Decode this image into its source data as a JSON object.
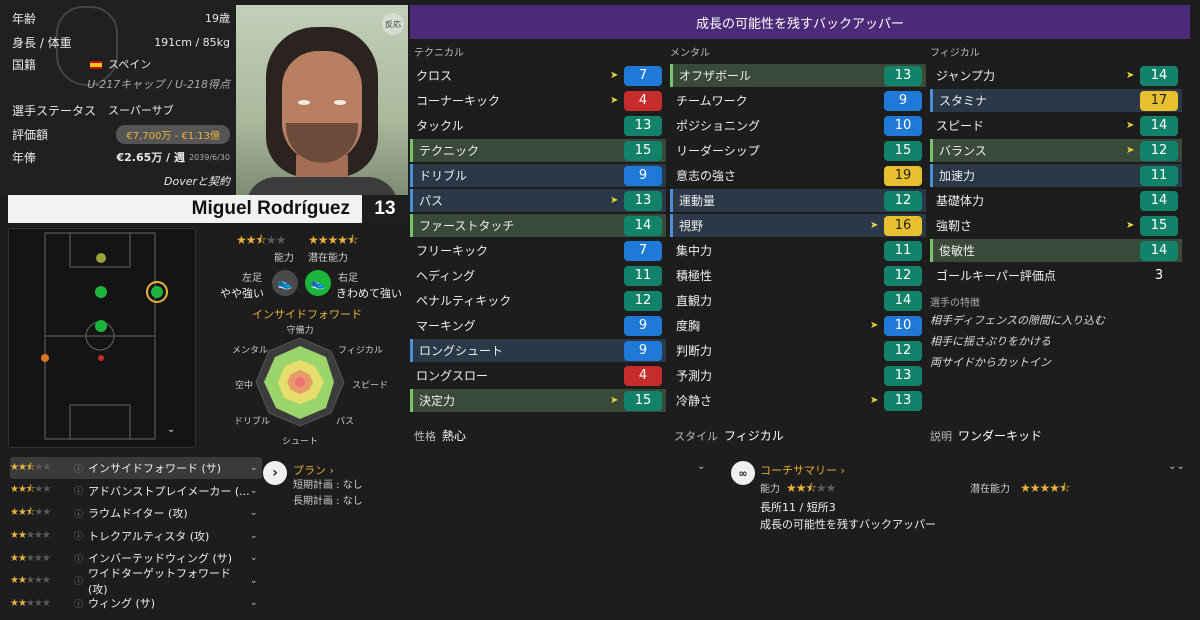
{
  "info": {
    "age_label": "年齢",
    "age_value": "19歳",
    "hw_label": "身長 / 体重",
    "hw_value": "191cm / 85kg",
    "nation_label": "国籍",
    "nation_value": "スペイン",
    "caps_value": "U-217キャップ / U-218得点",
    "status_label": "選手ステータス",
    "status_value": "スーパーサブ",
    "valuation_label": "評価額",
    "valuation_value": "€7,700万 - €1.13億",
    "wage_label": "年俸",
    "wage_value": "€2.65万 / 週",
    "wage_expiry": "2039/6/30",
    "club_text": "Doverと契約"
  },
  "portrait": {
    "react_label": "反応"
  },
  "player": {
    "name": "Miguel Rodríguez",
    "number": "13"
  },
  "ratings": {
    "ability_label": "能力",
    "potential_label": "潜在能力",
    "ability_stars": 2.5,
    "potential_stars": 4.5
  },
  "feet": {
    "left_label": "左足",
    "left_value": "やや強い",
    "right_label": "右足",
    "right_value": "きわめて強い"
  },
  "role_title": "インサイドフォワード",
  "radar": {
    "labels": [
      "守備力",
      "フィジカル",
      "スピード",
      "パス",
      "シュート",
      "ドリブル",
      "空中",
      "メンタル"
    ]
  },
  "header_title": "成長の可能性を残すバックアッパー",
  "columns": {
    "technical": "テクニカル",
    "mental": "メンタル",
    "physical": "フィジカル"
  },
  "technical": [
    {
      "name": "クロス",
      "value": "7",
      "color": "blue",
      "arrow": true,
      "hl": ""
    },
    {
      "name": "コーナーキック",
      "value": "4",
      "color": "red",
      "arrow": true,
      "hl": ""
    },
    {
      "name": "タックル",
      "value": "13",
      "color": "teal",
      "arrow": false,
      "hl": ""
    },
    {
      "name": "テクニック",
      "value": "15",
      "color": "teal",
      "arrow": false,
      "hl": "green"
    },
    {
      "name": "ドリブル",
      "value": "9",
      "color": "blue",
      "arrow": false,
      "hl": "blue"
    },
    {
      "name": "パス",
      "value": "13",
      "color": "teal",
      "arrow": true,
      "hl": "blue"
    },
    {
      "name": "ファーストタッチ",
      "value": "14",
      "color": "teal",
      "arrow": false,
      "hl": "green"
    },
    {
      "name": "フリーキック",
      "value": "7",
      "color": "blue",
      "arrow": false,
      "hl": ""
    },
    {
      "name": "ヘディング",
      "value": "11",
      "color": "teal",
      "arrow": false,
      "hl": ""
    },
    {
      "name": "ペナルティキック",
      "value": "12",
      "color": "teal",
      "arrow": false,
      "hl": ""
    },
    {
      "name": "マーキング",
      "value": "9",
      "color": "blue",
      "arrow": false,
      "hl": ""
    },
    {
      "name": "ロングシュート",
      "value": "9",
      "color": "blue",
      "arrow": false,
      "hl": "blue"
    },
    {
      "name": "ロングスロー",
      "value": "4",
      "color": "red",
      "arrow": false,
      "hl": ""
    },
    {
      "name": "決定力",
      "value": "15",
      "color": "teal",
      "arrow": true,
      "hl": "green"
    }
  ],
  "mental": [
    {
      "name": "オフザボール",
      "value": "13",
      "color": "teal",
      "arrow": false,
      "hl": "green"
    },
    {
      "name": "チームワーク",
      "value": "9",
      "color": "blue",
      "arrow": false,
      "hl": ""
    },
    {
      "name": "ポジショニング",
      "value": "10",
      "color": "blue",
      "arrow": false,
      "hl": ""
    },
    {
      "name": "リーダーシップ",
      "value": "15",
      "color": "teal",
      "arrow": false,
      "hl": ""
    },
    {
      "name": "意志の強さ",
      "value": "19",
      "color": "yel",
      "arrow": false,
      "hl": ""
    },
    {
      "name": "運動量",
      "value": "12",
      "color": "teal",
      "arrow": false,
      "hl": "blue"
    },
    {
      "name": "視野",
      "value": "16",
      "color": "yel",
      "arrow": true,
      "hl": "blue"
    },
    {
      "name": "集中力",
      "value": "11",
      "color": "teal",
      "arrow": false,
      "hl": ""
    },
    {
      "name": "積極性",
      "value": "12",
      "color": "teal",
      "arrow": false,
      "hl": ""
    },
    {
      "name": "直観力",
      "value": "14",
      "color": "teal",
      "arrow": false,
      "hl": ""
    },
    {
      "name": "度胸",
      "value": "10",
      "color": "blue",
      "arrow": true,
      "hl": ""
    },
    {
      "name": "判断力",
      "value": "12",
      "color": "teal",
      "arrow": false,
      "hl": ""
    },
    {
      "name": "予測力",
      "value": "13",
      "color": "teal",
      "arrow": false,
      "hl": ""
    },
    {
      "name": "冷静さ",
      "value": "13",
      "color": "teal",
      "arrow": true,
      "hl": ""
    }
  ],
  "physical": [
    {
      "name": "ジャンプ力",
      "value": "14",
      "color": "teal",
      "arrow": true,
      "hl": ""
    },
    {
      "name": "スタミナ",
      "value": "17",
      "color": "yel",
      "arrow": false,
      "hl": "blue"
    },
    {
      "name": "スピード",
      "value": "14",
      "color": "teal",
      "arrow": true,
      "hl": ""
    },
    {
      "name": "バランス",
      "value": "12",
      "color": "teal",
      "arrow": true,
      "hl": "green"
    },
    {
      "name": "加速力",
      "value": "11",
      "color": "teal",
      "arrow": false,
      "hl": "blue"
    },
    {
      "name": "基礎体力",
      "value": "14",
      "color": "teal",
      "arrow": false,
      "hl": ""
    },
    {
      "name": "強靭さ",
      "value": "15",
      "color": "teal",
      "arrow": true,
      "hl": ""
    },
    {
      "name": "俊敏性",
      "value": "14",
      "color": "teal",
      "arrow": false,
      "hl": "green"
    },
    {
      "name": "ゴールキーパー評価点",
      "value": "3",
      "color": "plain",
      "arrow": false,
      "hl": ""
    }
  ],
  "traits": {
    "title": "選手の特徴",
    "items": [
      "相手ディフェンスの隙間に入り込む",
      "相手に揺さぶりをかける",
      "両サイドからカットイン"
    ]
  },
  "bottom": {
    "personality_label": "性格",
    "personality_value": "熱心",
    "style_label": "スタイル",
    "style_value": "フィジカル",
    "desc_label": "説明",
    "desc_value": "ワンダーキッド"
  },
  "roles": [
    {
      "stars": 2.5,
      "name": "インサイドフォワード (サ)"
    },
    {
      "stars": 2.5,
      "name": "アドバンストプレイメーカー (..."
    },
    {
      "stars": 2.5,
      "name": "ラウムドイター (攻)"
    },
    {
      "stars": 2,
      "name": "トレクアルティスタ (攻)"
    },
    {
      "stars": 2,
      "name": "インバーテッドウィング (サ)"
    },
    {
      "stars": 2,
      "name": "ワイドターゲットフォワード (攻)"
    },
    {
      "stars": 2,
      "name": "ウィング (サ)"
    }
  ],
  "plan": {
    "title": "プラン",
    "short_label": "短期計画",
    "short_value": "なし",
    "long_label": "長期計画",
    "long_value": "なし"
  },
  "coach": {
    "title": "コーチサマリー",
    "ability_label": "能力",
    "potential_label": "潜在能力",
    "ability_stars": 2.5,
    "potential_stars": 4.5,
    "strength": "長所11 / 短所3",
    "summary": "成長の可能性を残すバックアッパー"
  }
}
